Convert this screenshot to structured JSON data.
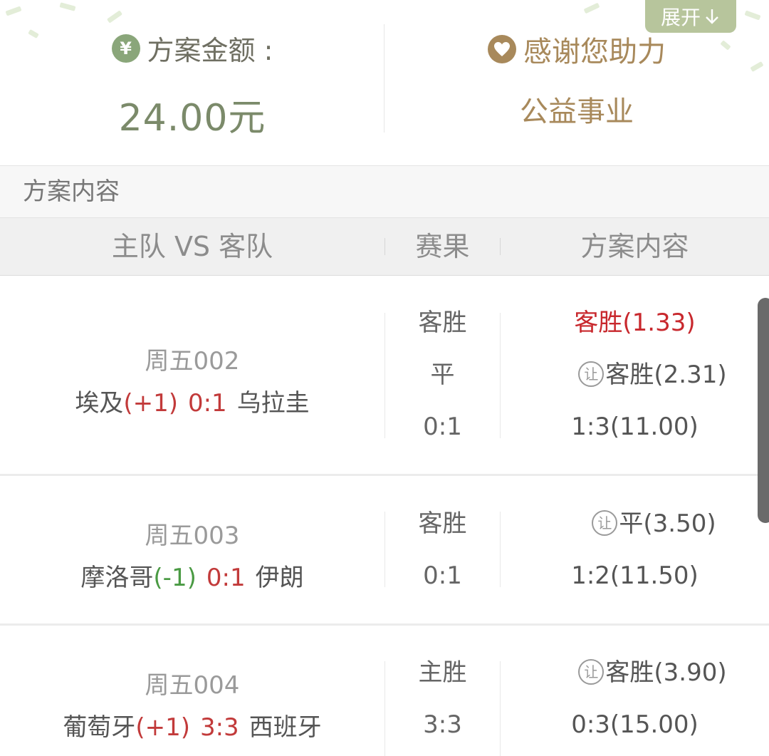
{
  "summary": {
    "expand_label": "展开",
    "amount_icon": "¥",
    "amount_label": "方案金额 :",
    "amount_value": "24.00元",
    "thanks_title": "感谢您助力",
    "thanks_sub": "公益事业"
  },
  "section_label": "方案内容",
  "table_headers": {
    "teams": "主队 VS 客队",
    "result": "赛果",
    "content": "方案内容"
  },
  "rang_icon_text": "让",
  "matches": [
    {
      "match_no": "周五002",
      "home": "埃及",
      "handicap": "(+1)",
      "score": "0:1",
      "away": "乌拉圭",
      "results": [
        "客胜",
        "平",
        "0:1"
      ],
      "picks": [
        {
          "label": "客胜",
          "odds": "(1.33)"
        },
        {
          "label": "客胜",
          "odds": "(2.31)"
        },
        {
          "label": "1:3",
          "odds": "(11.00)"
        }
      ]
    },
    {
      "match_no": "周五003",
      "home": "摩洛哥",
      "handicap": "(-1)",
      "score": "0:1",
      "away": "伊朗",
      "results": [
        "客胜",
        "0:1"
      ],
      "picks": [
        {
          "label": "平",
          "odds": "(3.50)"
        },
        {
          "label": "1:2",
          "odds": "(11.50)"
        }
      ]
    },
    {
      "match_no": "周五004",
      "home": "葡萄牙",
      "handicap": "(+1)",
      "score": "3:3",
      "away": "西班牙",
      "results": [
        "主胜",
        "3:3"
      ],
      "picks": [
        {
          "label": "客胜",
          "odds": "(3.90)"
        },
        {
          "label": "0:3",
          "odds": "(15.00)"
        }
      ]
    }
  ]
}
